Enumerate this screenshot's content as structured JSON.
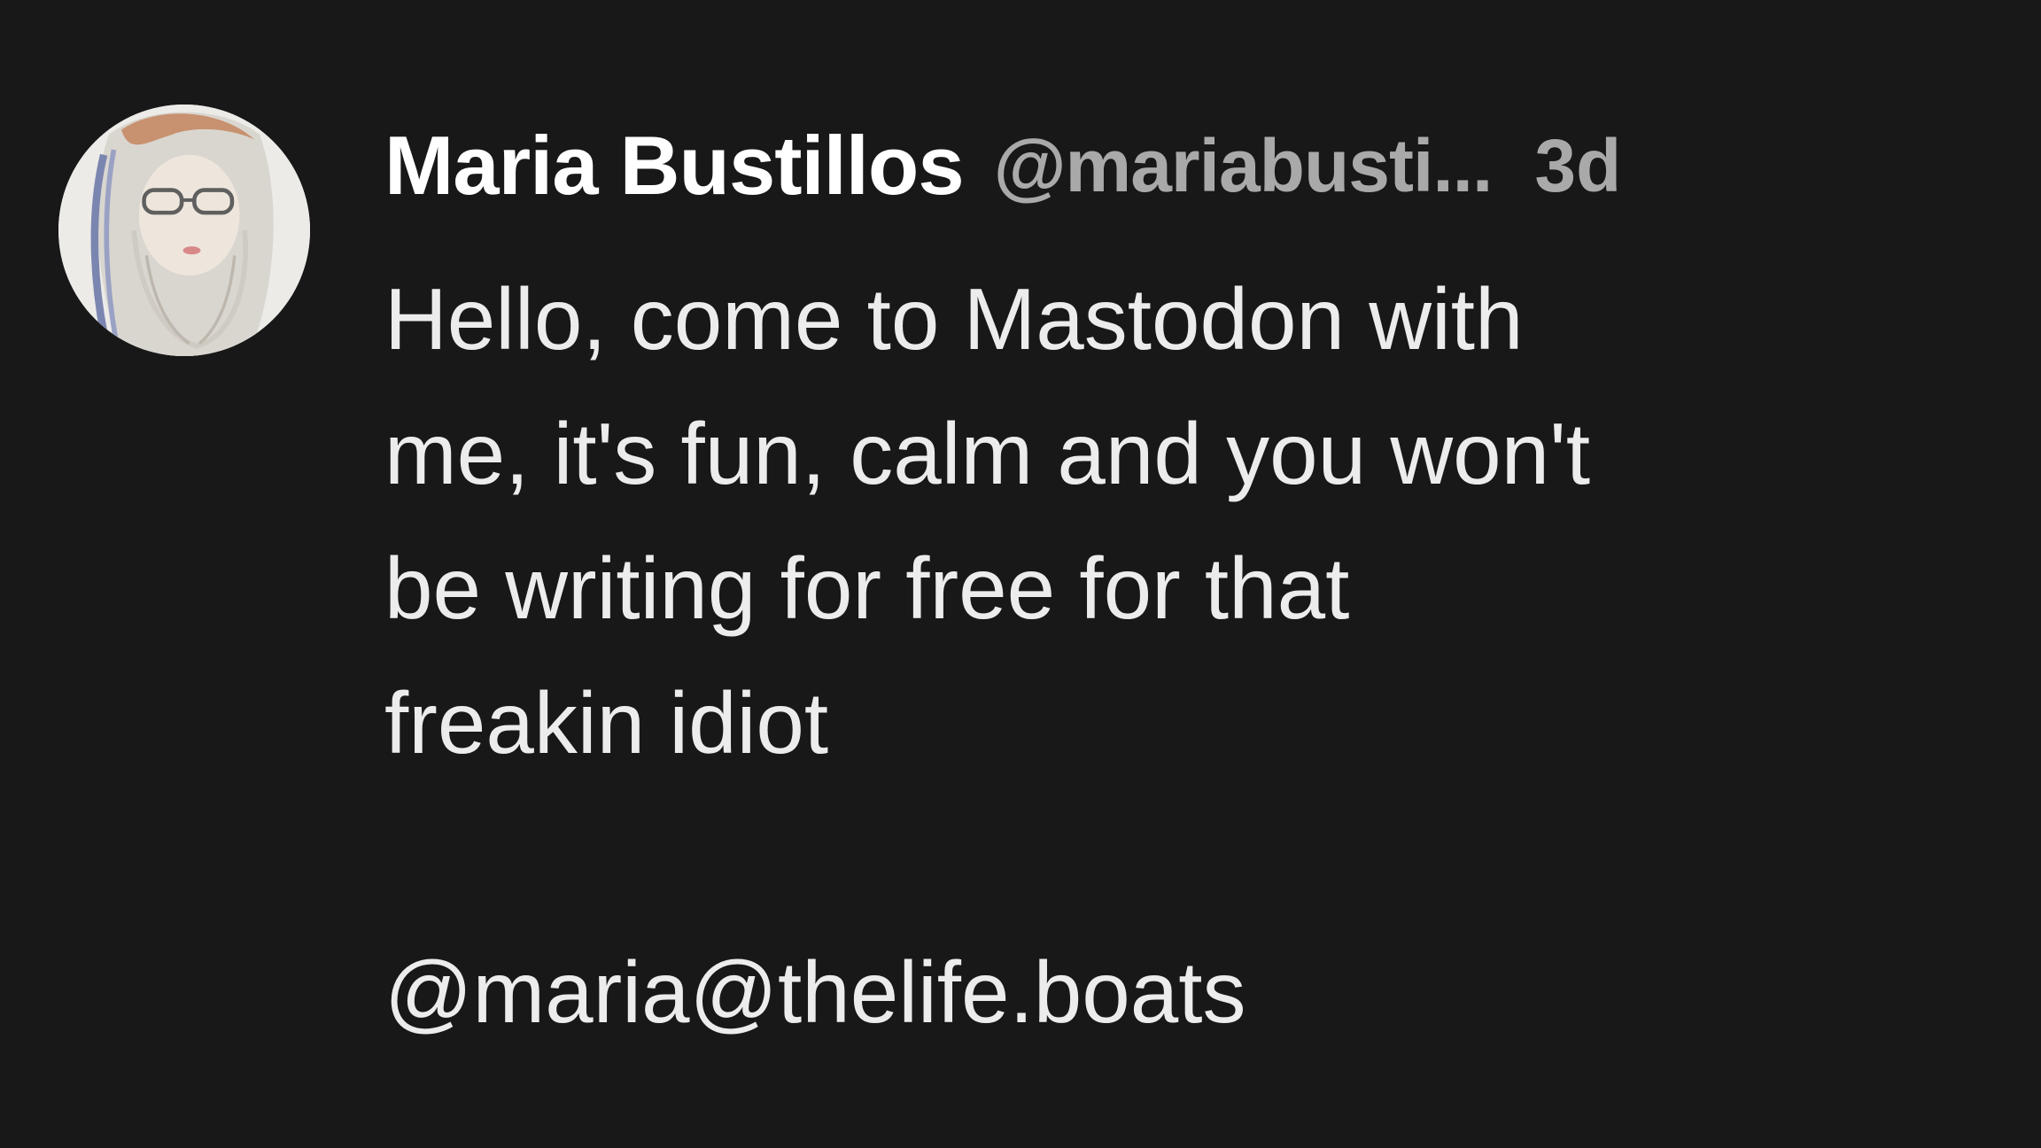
{
  "post": {
    "author": {
      "display_name": "Maria Bustillos",
      "handle": "@mariabusti...",
      "avatar_icon": "user-avatar-drawing"
    },
    "timestamp": "3d",
    "content": {
      "lines": [
        "Hello, come to Mastodon with",
        "me, it's fun, calm and you won't",
        "be writing for free for that",
        "freakin idiot"
      ],
      "mention": "@maria@thelife.boats"
    }
  },
  "colors": {
    "background": "#181818",
    "name": "#ffffff",
    "meta": "#a9a9a9",
    "text": "#ececec"
  }
}
